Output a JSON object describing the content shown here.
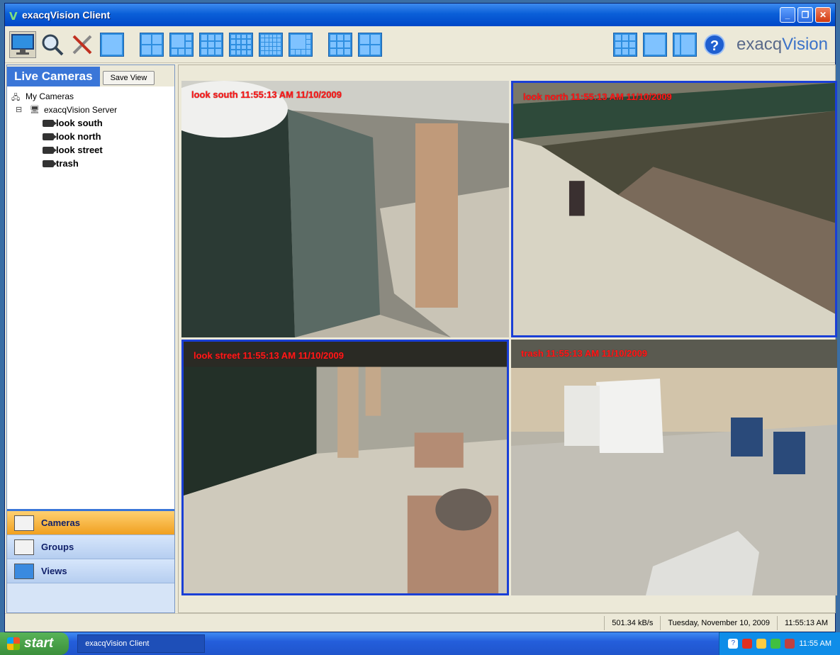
{
  "window": {
    "title": "exacqVision Client"
  },
  "toolbar": {
    "logo_prefix": "exacq",
    "logo_suffix": "Vision",
    "help_glyph": "?"
  },
  "sidebar": {
    "tab_label": "Live Cameras",
    "save_view_label": "Save View",
    "tree": {
      "root": "My Cameras",
      "server": "exacqVision Server",
      "cameras": [
        "look south",
        "look north",
        "look street",
        "trash"
      ]
    },
    "nav": [
      {
        "label": "Cameras",
        "icon": "camera-icon",
        "active": true
      },
      {
        "label": "Groups",
        "icon": "group-icon",
        "active": false
      },
      {
        "label": "Views",
        "icon": "views-icon",
        "active": false
      }
    ]
  },
  "video": {
    "tiles": [
      {
        "overlay": "look south 11:55:13 AM 11/10/2009",
        "selected": false
      },
      {
        "overlay": "look north 11:55:13 AM 11/10/2009",
        "selected": true
      },
      {
        "overlay": "look street 11:55:13 AM 11/10/2009",
        "selected": true
      },
      {
        "overlay": "trash 11:55:13 AM 11/10/2009",
        "selected": false
      }
    ]
  },
  "status": {
    "rate": "501.34 kB/s",
    "date": "Tuesday, November 10, 2009",
    "time": "11:55:13 AM"
  },
  "taskbar": {
    "start_label": "start",
    "task_label": "exacqVision Client",
    "clock": "11:55 AM"
  }
}
